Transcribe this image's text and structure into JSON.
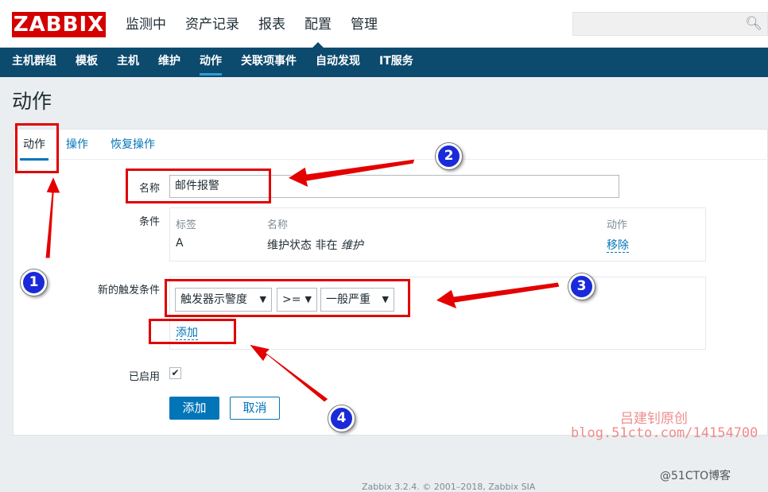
{
  "brand": {
    "logo": "ZABBIX",
    "color": "#d40000"
  },
  "top_nav": {
    "items": [
      {
        "label": "监测中",
        "selected": false
      },
      {
        "label": "资产记录",
        "selected": false
      },
      {
        "label": "报表",
        "selected": false
      },
      {
        "label": "配置",
        "selected": true
      },
      {
        "label": "管理",
        "selected": false
      }
    ],
    "search_icon": "search-icon"
  },
  "sub_nav": {
    "items": [
      {
        "label": "主机群组"
      },
      {
        "label": "模板"
      },
      {
        "label": "主机"
      },
      {
        "label": "维护"
      },
      {
        "label": "动作",
        "selected": true
      },
      {
        "label": "关联项事件"
      },
      {
        "label": "自动发现"
      },
      {
        "label": "IT服务"
      }
    ]
  },
  "page": {
    "title": "动作"
  },
  "tabs": [
    {
      "label": "动作",
      "active": true
    },
    {
      "label": "操作",
      "active": false
    },
    {
      "label": "恢复操作",
      "active": false
    }
  ],
  "form": {
    "name_label": "名称",
    "name_value": "邮件报警",
    "conditions_label": "条件",
    "conditions_table": {
      "headers": [
        "标签",
        "名称",
        "动作"
      ],
      "rows": [
        {
          "tag": "A",
          "name_prefix": "维护状态 非在 ",
          "name_italic": "维护",
          "action": "移除"
        }
      ]
    },
    "new_condition_label": "新的触发条件",
    "condition_type": "触发器示警度",
    "operator": ">=",
    "severity": "一般严重",
    "add_link": "添加",
    "enabled_label": "已启用",
    "enabled": true,
    "submit_button": "添加",
    "cancel_button": "取消"
  },
  "annotations": {
    "badges": [
      "1",
      "2",
      "3",
      "4"
    ],
    "color": "#e00000"
  },
  "watermarks": {
    "author": "吕建钊原创",
    "blog": "blog.51cto.com/14154700",
    "site": "@51CTO博客"
  },
  "footer": "Zabbix 3.2.4. © 2001–2018, Zabbix SIA"
}
